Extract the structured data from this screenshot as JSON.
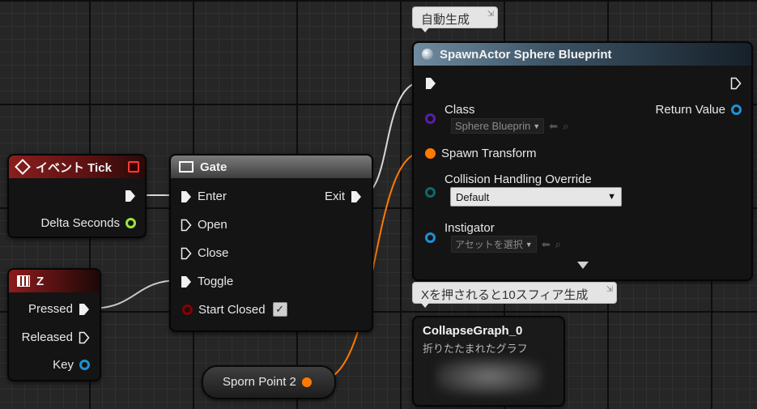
{
  "comments": {
    "spawn_comment": "自動生成",
    "collapse_comment": "Xを押されると10スフィア生成"
  },
  "event_tick": {
    "title": "イベント Tick",
    "pin_delta": "Delta Seconds"
  },
  "z_key": {
    "title": "Z",
    "pin_pressed": "Pressed",
    "pin_released": "Released",
    "pin_key": "Key"
  },
  "gate": {
    "title": "Gate",
    "pin_enter": "Enter",
    "pin_open": "Open",
    "pin_close": "Close",
    "pin_toggle": "Toggle",
    "pin_start_closed": "Start Closed",
    "pin_exit": "Exit",
    "start_closed_checked": true
  },
  "spawn_actor": {
    "title": "SpawnActor Sphere Blueprint",
    "pin_class": "Class",
    "class_value": "Sphere Blueprin",
    "pin_return": "Return Value",
    "pin_spawn_transform": "Spawn Transform",
    "pin_collision": "Collision Handling Override",
    "collision_value": "Default",
    "pin_instigator": "Instigator",
    "instigator_value": "アセットを選択"
  },
  "collapse_graph": {
    "title": "CollapseGraph_0",
    "subtitle": "折りたたまれたグラフ"
  },
  "variable": {
    "label": "Sporn Point 2"
  },
  "colors": {
    "exec_white": "#f0f0f0",
    "float_green": "#9be43f",
    "struct_blue": "#1e90d6",
    "class_purple": "#5a1cb0",
    "transform_orange": "#ff7a00",
    "teal": "#0b6b6b",
    "bool_red": "#8a0000"
  }
}
